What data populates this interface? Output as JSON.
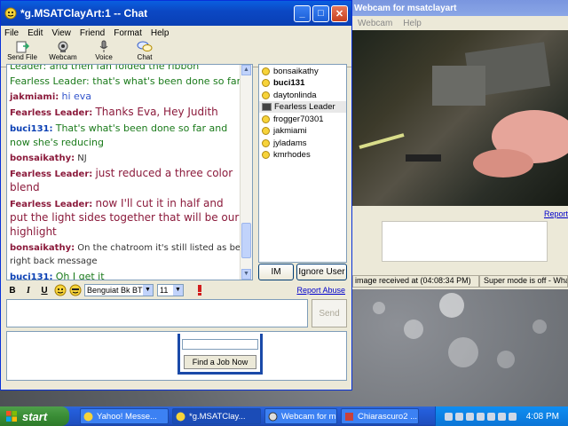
{
  "chat_window": {
    "title": "*g.MSATClayArt:1 -- Chat",
    "menu": [
      "File",
      "Edit",
      "View",
      "Friend",
      "Format",
      "Help"
    ],
    "toolbar": [
      "Send File",
      "Webcam",
      "Voice",
      "Chat"
    ],
    "messages": [
      {
        "nick": "",
        "text": "Leader: and then fan folded the ribbon",
        "style": "green"
      },
      {
        "nick": "",
        "text": "Fearless Leader: that's what's been done so far",
        "style": "green"
      },
      {
        "nick": "jakmiami:",
        "text": "hi eva",
        "style": "blue"
      },
      {
        "nick": "Fearless Leader:",
        "text": "Thanks Eva, Hey Judith",
        "style": "fl"
      },
      {
        "nick": "buci131:",
        "text": "That's what's been done so far and now she's reducing",
        "style": "green"
      },
      {
        "nick": "bonsaikathy:",
        "text": "NJ",
        "style": "bons"
      },
      {
        "nick": "Fearless Leader:",
        "text": "just reduced a three color blend",
        "style": "fl"
      },
      {
        "nick": "Fearless Leader:",
        "text": "now I'll cut it in half and put the light sides together that will be our highlight",
        "style": "fl"
      },
      {
        "nick": "bonsaikathy:",
        "text": "On the chatroom it's still listed as be right back message",
        "style": "bons"
      },
      {
        "nick": "buci131:",
        "text": "Oh I get it",
        "style": "green"
      }
    ],
    "users": [
      {
        "name": "bonsaikathy",
        "icon": "smile-icon",
        "bold": false,
        "selected": false
      },
      {
        "name": "buci131",
        "icon": "smile-icon",
        "bold": true,
        "selected": false
      },
      {
        "name": "daytonlinda",
        "icon": "smile-icon",
        "bold": false,
        "selected": false
      },
      {
        "name": "Fearless Leader",
        "icon": "webcam-icon",
        "bold": false,
        "selected": true
      },
      {
        "name": "frogger70301",
        "icon": "smile-icon",
        "bold": false,
        "selected": false
      },
      {
        "name": "jakmiami",
        "icon": "smile-icon",
        "bold": false,
        "selected": false
      },
      {
        "name": "jyladams",
        "icon": "smile-icon",
        "bold": false,
        "selected": false
      },
      {
        "name": "kmrhodes",
        "icon": "smile-icon",
        "bold": false,
        "selected": false
      }
    ],
    "im_button": "IM",
    "ignore_button": "Ignore User",
    "format": {
      "bold": "B",
      "italic": "I",
      "underline": "U",
      "font": "Benguiat Bk BT",
      "size": "11"
    },
    "report_abuse": "Report Abuse",
    "send_button": "Send",
    "ad_button": "Find a Job Now"
  },
  "webcam_window": {
    "title": "Webcam for msatclayart",
    "menu": [
      "Webcam",
      "Help"
    ],
    "report_link": "Report",
    "status_left": "image received at (04:08:34 PM)",
    "status_right": "Super mode is off - What"
  },
  "taskbar": {
    "start": "start",
    "tasks": [
      {
        "label": "Yahoo! Messe...",
        "active": false
      },
      {
        "label": "*g.MSATClay...",
        "active": true
      },
      {
        "label": "Webcam for m...",
        "active": false
      },
      {
        "label": "Chiarascuro2 ...",
        "active": false
      }
    ],
    "clock": "4:08 PM"
  },
  "colors": {
    "titlebar": "#0a5fe0",
    "taskbar": "#245edb",
    "start": "#3a8d36",
    "fearless_leader": "#8b1a3b",
    "green_text": "#1a7a1a"
  }
}
